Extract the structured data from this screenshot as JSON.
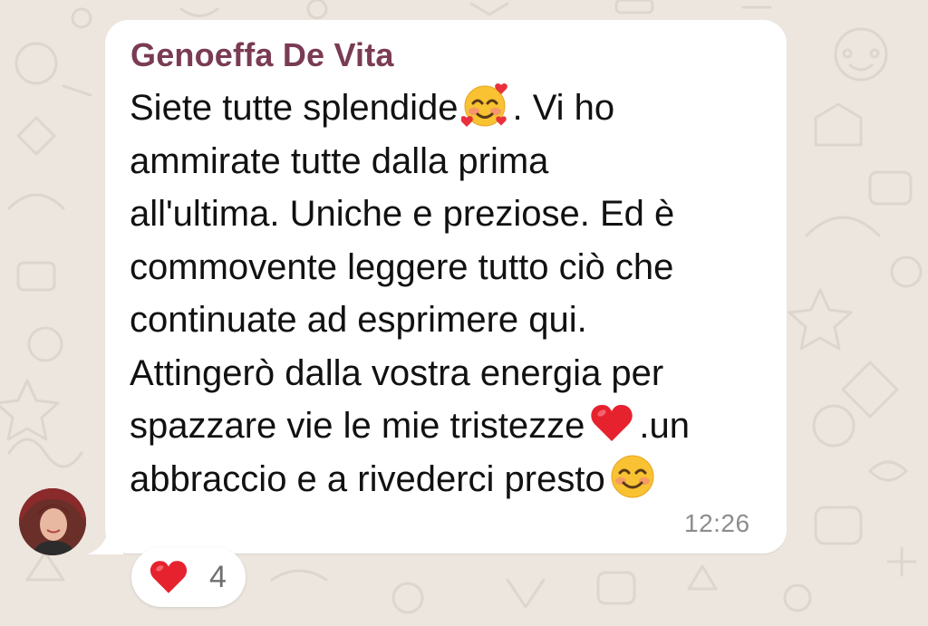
{
  "chat": {
    "background_color": "#ece6df",
    "bubble_color": "#ffffff"
  },
  "message": {
    "sender": "Genoeffa De Vita",
    "sender_color": "#7a3b54",
    "lines": [
      "Siete tutte splendide",
      ". Vi ho",
      "ammirate tutte dalla prima",
      "all'ultima. Uniche e preziose. Ed è",
      "commovente leggere tutto ciò che",
      "continuate ad esprimere qui.",
      "Attingerò dalla vostra energia per",
      "spazzare vie le mie tristezze",
      ".un",
      "abbraccio e a rivederci presto"
    ],
    "emojis": [
      "smiling-face-with-hearts-icon",
      "red-heart-icon",
      "smiling-face-with-smiling-eyes-icon"
    ],
    "time": "12:26"
  },
  "reactions": {
    "emoji": "red-heart-icon",
    "count": "4"
  },
  "avatar": {
    "name": "sender-avatar"
  }
}
